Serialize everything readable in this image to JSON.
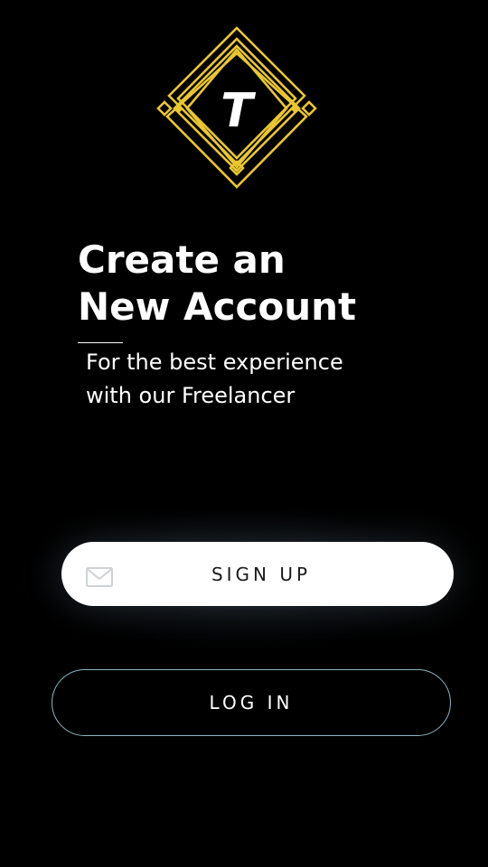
{
  "logo": {
    "letter": "T",
    "icon": "gold-diamond-logo",
    "color": "#e9c72e"
  },
  "header": {
    "title_line1": "Create an",
    "title_line2": "New Account",
    "subtitle_line1": "For the best experience",
    "subtitle_line2": "with our Freelancer"
  },
  "actions": {
    "signup_label": "SIGN UP",
    "signup_icon": "mail-icon",
    "login_label": "LOG IN"
  },
  "colors": {
    "background": "#000000",
    "accent_gold": "#e9c72e",
    "login_border": "#8fb4c0",
    "signup_bg": "#ffffff"
  }
}
